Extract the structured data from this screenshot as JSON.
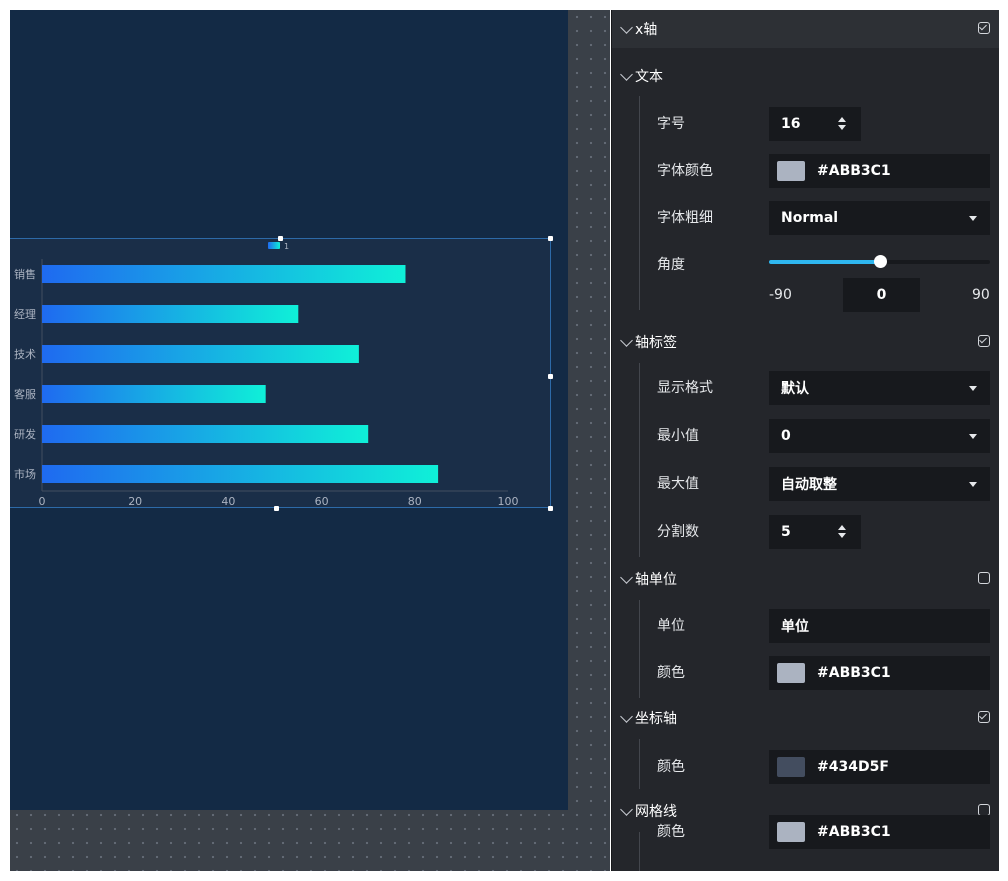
{
  "chart_data": {
    "type": "bar",
    "orientation": "horizontal",
    "categories": [
      "销售",
      "经理",
      "技术",
      "客服",
      "研发",
      "市场"
    ],
    "values": [
      78,
      55,
      68,
      48,
      70,
      85
    ],
    "xlim": [
      0,
      100
    ],
    "xticks": [
      "0",
      "20",
      "40",
      "60",
      "80",
      "100"
    ],
    "legend_label": "1",
    "gradient": [
      "#1f6af0",
      "#0ff0d8"
    ]
  },
  "panel": {
    "sections": {
      "x_axis": {
        "label": "x轴",
        "checked": true
      },
      "text": {
        "label": "文本"
      },
      "axis_label": {
        "label": "轴标签",
        "checked": true
      },
      "axis_unit": {
        "label": "轴单位",
        "checked": false
      },
      "coord_axis": {
        "label": "坐标轴",
        "checked": true
      },
      "grid_line": {
        "label": "网格线",
        "checked": false
      }
    },
    "text": {
      "font_size_label": "字号",
      "font_size_value": "16",
      "font_color_label": "字体颜色",
      "font_color_value": "#ABB3C1",
      "font_color_hex": "#ABB3C1",
      "font_weight_label": "字体粗细",
      "font_weight_value": "Normal",
      "angle_label": "角度",
      "angle_min": "-90",
      "angle_value": "0",
      "angle_max": "90"
    },
    "axis_label": {
      "format_label": "显示格式",
      "format_value": "默认",
      "min_label": "最小值",
      "min_value": "0",
      "max_label": "最大值",
      "max_value": "自动取整",
      "split_label": "分割数",
      "split_value": "5"
    },
    "axis_unit": {
      "unit_label": "单位",
      "unit_value": "单位",
      "color_label": "颜色",
      "color_value": "#ABB3C1",
      "color_hex": "#ABB3C1"
    },
    "coord_axis": {
      "color_label": "颜色",
      "color_value": "#434D5F",
      "color_hex": "#434D5F"
    },
    "grid_line": {
      "color_label": "颜色",
      "color_value": "#ABB3C1",
      "color_hex": "#ABB3C1"
    }
  }
}
